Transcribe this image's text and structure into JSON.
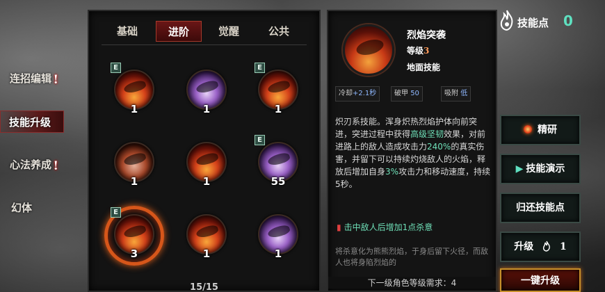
{
  "nav": {
    "items": [
      {
        "label": "连招编辑",
        "alert": "!"
      },
      {
        "label": "技能升级",
        "alert": ""
      },
      {
        "label": "心法养成",
        "alert": "!"
      },
      {
        "label": "幻体",
        "alert": ""
      }
    ],
    "active_index": 1
  },
  "tabs": [
    {
      "label": "基础"
    },
    {
      "label": "进阶"
    },
    {
      "label": "觉醒"
    },
    {
      "label": "公共"
    }
  ],
  "active_tab": "进阶",
  "skills": [
    {
      "level": "1",
      "badge": "E",
      "color": "fire"
    },
    {
      "level": "1",
      "badge": "",
      "color": "purple"
    },
    {
      "level": "1",
      "badge": "E",
      "color": "fire"
    },
    {
      "level": "1",
      "badge": "",
      "color": "ash"
    },
    {
      "level": "1",
      "badge": "",
      "color": "fire"
    },
    {
      "level": "55",
      "badge": "E",
      "color": "purple"
    },
    {
      "level": "3",
      "badge": "E",
      "color": "fire",
      "selected": true
    },
    {
      "level": "1",
      "badge": "",
      "color": "fire"
    },
    {
      "level": "1",
      "badge": "",
      "color": "purple"
    }
  ],
  "page_indicator": "15/15",
  "detail": {
    "name": "烈焰突袭",
    "level_label": "等级",
    "level_value": "3",
    "type": "地面技能",
    "stats": [
      {
        "label": "冷却",
        "value": "+2.1秒"
      },
      {
        "label": "破甲",
        "value": "50"
      },
      {
        "label": "吸附",
        "value": "低"
      }
    ],
    "desc_parts": [
      "炽刃系技能。浑身炽热烈焰护体向前突进，突进过程中获得",
      "高级坚韧",
      "效果，对前进路上的敌人造成攻击力",
      "240%",
      "的真实伤害，并留下可以持续灼烧敌人的火焰，释放后增加自身",
      "3%",
      "攻击力和移动速度，持续5秒。"
    ],
    "extra": "击中敌人后增加1点杀意",
    "footnote": "将杀意化为熊熊烈焰，于身后留下火径，而敌人也将身陷烈焰的",
    "requirement": "下一级角色等级需求：4"
  },
  "right": {
    "points_label": "技能点",
    "points_value": "0",
    "btn_refine": "精研",
    "btn_demo": "技能演示",
    "btn_refund": "归还技能点",
    "btn_upgrade_label": "升级",
    "btn_upgrade_cost": "1",
    "btn_one_click": "一键升级"
  },
  "colors": {
    "accent_green": "#5fe0c0",
    "accent_red": "#8a2c2c",
    "fire_orange": "#d6561a"
  }
}
